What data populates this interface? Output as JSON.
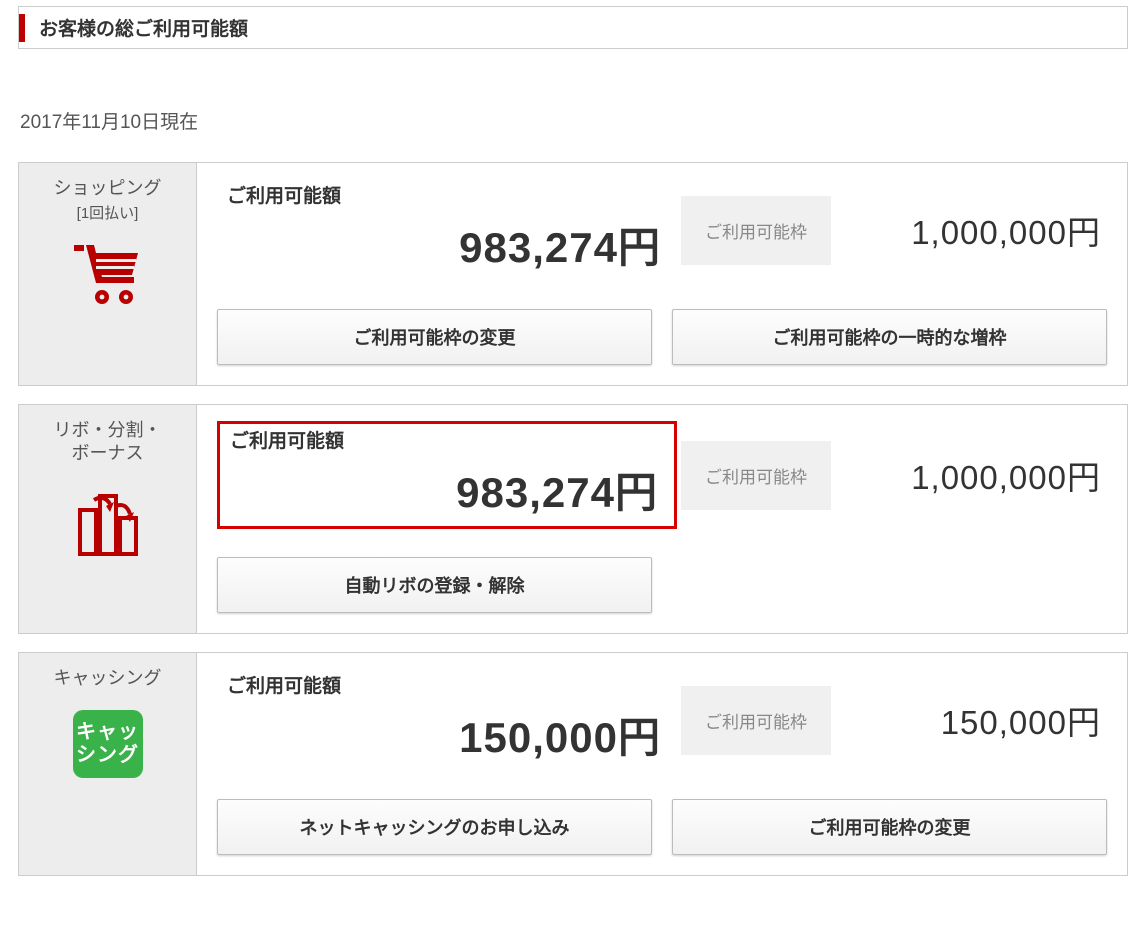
{
  "header": {
    "title": "お客様の総ご利用可能額"
  },
  "as_of_date": "2017年11月10日現在",
  "common": {
    "available_label": "ご利用可能額",
    "limit_label": "ご利用可能枠"
  },
  "sections": {
    "shopping": {
      "title": "ショッピング",
      "subtitle": "[1回払い]",
      "available_amount": "983,274円",
      "limit_amount": "1,000,000円",
      "buttons": {
        "change_limit": "ご利用可能枠の変更",
        "temp_increase": "ご利用可能枠の一時的な増枠"
      }
    },
    "revolving": {
      "title": "リボ・分割・\nボーナス",
      "available_amount": "983,274円",
      "limit_amount": "1,000,000円",
      "buttons": {
        "auto_revo": "自動リボの登録・解除"
      }
    },
    "cashing": {
      "title": "キャッシング",
      "badge_line1": "キャッ",
      "badge_line2": "シング",
      "available_amount": "150,000円",
      "limit_amount": "150,000円",
      "buttons": {
        "apply": "ネットキャッシングのお申し込み",
        "change_limit": "ご利用可能枠の変更"
      }
    }
  }
}
